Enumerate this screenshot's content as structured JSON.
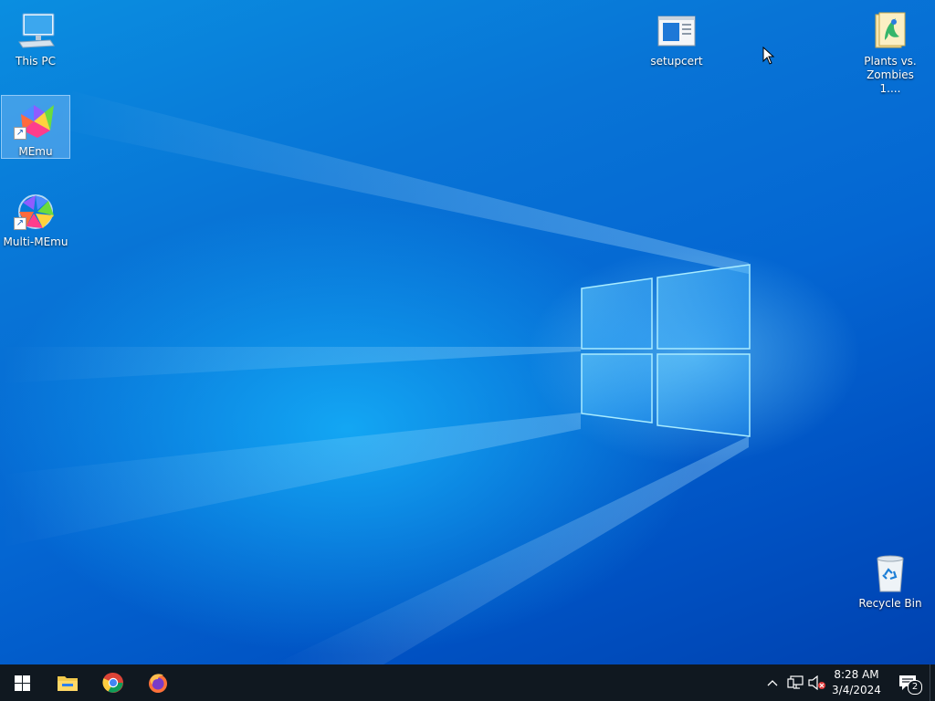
{
  "desktop": {
    "icons": [
      {
        "label": "This PC",
        "icon": "this-pc-icon"
      },
      {
        "label": "MEmu",
        "icon": "memu-icon"
      },
      {
        "label": "Multi-MEmu",
        "icon": "multi-memu-icon"
      },
      {
        "label": "setupcert",
        "icon": "setupcert-icon"
      },
      {
        "label": "Plants vs. Zombies 1....",
        "icon": "folder-icon"
      },
      {
        "label": "Recycle Bin",
        "icon": "recycle-bin-icon"
      }
    ]
  },
  "taskbar": {
    "pinned": [
      {
        "name": "Start",
        "icon": "windows-logo-icon"
      },
      {
        "name": "File Explorer",
        "icon": "file-explorer-icon"
      },
      {
        "name": "Google Chrome",
        "icon": "chrome-icon"
      },
      {
        "name": "Firefox",
        "icon": "firefox-icon"
      }
    ],
    "tray": {
      "time": "8:28 AM",
      "date": "3/4/2024",
      "notification_count": "2"
    }
  },
  "colors": {
    "taskbar": "#101820",
    "wallpaper_accent": "#0874d6"
  }
}
